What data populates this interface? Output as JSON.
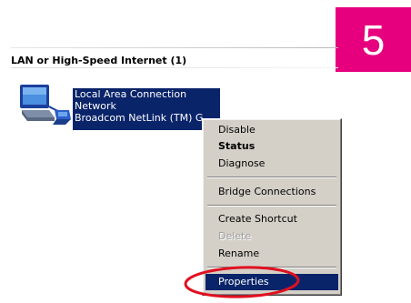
{
  "step_badge": {
    "number": "5",
    "color": "#e6007e"
  },
  "section": {
    "title": "LAN or High-Speed Internet (1)"
  },
  "connection": {
    "icon": "network-connection-icon",
    "name": "Local Area Connection",
    "status": "Network",
    "device": "Broadcom NetLink (TM) G",
    "selection_color": "#0a246a"
  },
  "context_menu": {
    "items": [
      {
        "label": "Disable",
        "bold": false,
        "disabled": false,
        "highlighted": false
      },
      {
        "label": "Status",
        "bold": true,
        "disabled": false,
        "highlighted": false
      },
      {
        "label": "Diagnose",
        "bold": false,
        "disabled": false,
        "highlighted": false
      },
      {
        "label": "Bridge Connections",
        "bold": false,
        "disabled": false,
        "highlighted": false
      },
      {
        "label": "Create Shortcut",
        "bold": false,
        "disabled": false,
        "highlighted": false
      },
      {
        "label": "Delete",
        "bold": false,
        "disabled": true,
        "highlighted": false
      },
      {
        "label": "Rename",
        "bold": false,
        "disabled": false,
        "highlighted": false
      },
      {
        "label": "Properties",
        "bold": false,
        "disabled": false,
        "highlighted": true
      }
    ]
  },
  "annotation": {
    "type": "highlight-ellipse",
    "color": "#e01020",
    "target": "Properties"
  }
}
